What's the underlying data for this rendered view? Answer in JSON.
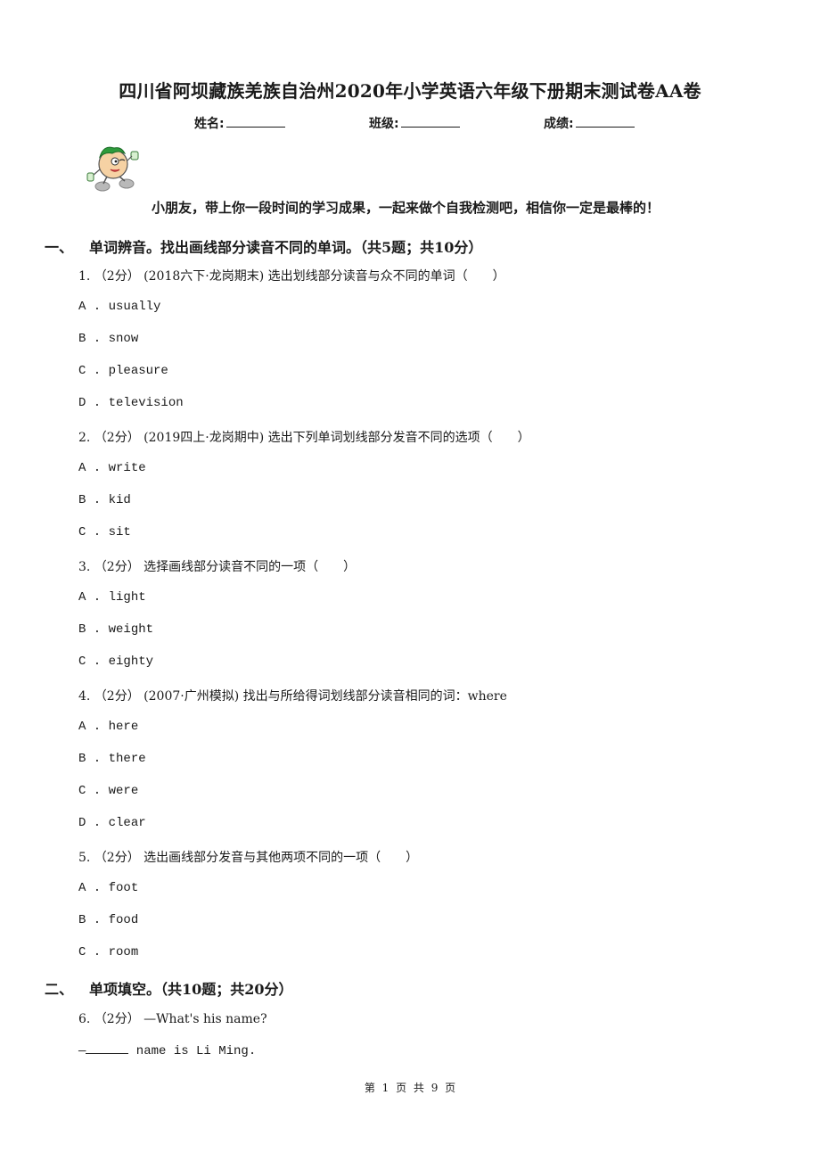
{
  "document": {
    "title": "四川省阿坝藏族羌族自治州2020年小学英语六年级下册期末测试卷AA卷",
    "fields": [
      {
        "label": "姓名:",
        "value": ""
      },
      {
        "label": "班级:",
        "value": ""
      },
      {
        "label": "成绩:",
        "value": ""
      }
    ],
    "mascot_icon": "cartoon-boy-icon",
    "encouragement": "小朋友，带上你一段时间的学习成果，一起来做个自我检测吧，相信你一定是最棒的！"
  },
  "sections": [
    {
      "number": "一、",
      "heading": "单词辨音。找出画线部分读音不同的单词。（共5题；共10分）",
      "questions": [
        {
          "text": "1. （2分） (2018六下·龙岗期末) 选出划线部分读音与众不同的单词（　　）",
          "options": [
            {
              "letter": "A .",
              "word": "usually"
            },
            {
              "letter": "B .",
              "word": "snow"
            },
            {
              "letter": "C .",
              "word": "pleasure"
            },
            {
              "letter": "D .",
              "word": "television"
            }
          ]
        },
        {
          "text": "2. （2分） (2019四上·龙岗期中) 选出下列单词划线部分发音不同的选项（　　）",
          "options": [
            {
              "letter": "A .",
              "word": "write"
            },
            {
              "letter": "B .",
              "word": "kid"
            },
            {
              "letter": "C .",
              "word": "sit"
            }
          ]
        },
        {
          "text": "3. （2分） 选择画线部分读音不同的一项（　　）",
          "options": [
            {
              "letter": "A .",
              "word": "light"
            },
            {
              "letter": "B .",
              "word": "weight"
            },
            {
              "letter": "C .",
              "word": "eighty"
            }
          ]
        },
        {
          "text": "4. （2分） (2007·广州模拟) 找出与所给得词划线部分读音相同的词：where",
          "options": [
            {
              "letter": "A .",
              "word": "here"
            },
            {
              "letter": "B .",
              "word": "there"
            },
            {
              "letter": "C .",
              "word": "were"
            },
            {
              "letter": "D .",
              "word": "clear"
            }
          ]
        },
        {
          "text": "5. （2分） 选出画线部分发音与其他两项不同的一项（　　）",
          "options": [
            {
              "letter": "A .",
              "word": "foot"
            },
            {
              "letter": "B .",
              "word": "food"
            },
            {
              "letter": "C .",
              "word": "room"
            }
          ]
        }
      ]
    },
    {
      "number": "二、",
      "heading": "单项填空。（共10题；共20分）",
      "questions": [
        {
          "text": "6. （2分） —What's his name?",
          "answer_prefix": "—",
          "answer_suffix": " name is Li Ming."
        }
      ]
    }
  ],
  "footer": {
    "page_label": "第 1 页 共 9 页"
  }
}
